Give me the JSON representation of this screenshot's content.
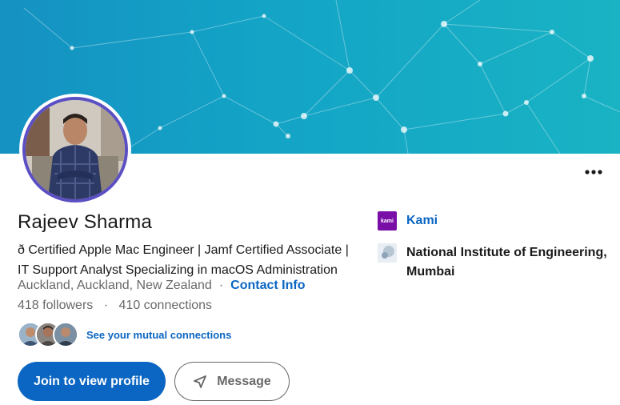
{
  "profile": {
    "name": "Rajeev Sharma",
    "headline": "ð Certified Apple Mac Engineer | Jamf Certified Associate | IT Support Analyst Specializing in macOS Administration",
    "location": "Auckland, Auckland, New Zealand",
    "separator": "·",
    "contact_info_label": "Contact Info",
    "followers": "418 followers",
    "connections": "410 connections"
  },
  "mutual": {
    "label": "See your mutual connections"
  },
  "actions": {
    "join_label": "Join to view profile",
    "message_label": "Message",
    "more_icon": "ellipsis-icon"
  },
  "experience": {
    "company": "Kami",
    "company_logo_text": "kami",
    "school": "National Institute of Engineering, Mumbai"
  },
  "colors": {
    "accent": "#0a66c2",
    "banner_start": "#1591c2",
    "banner_end": "#19b3c4",
    "kami_brand": "#7a0fa8",
    "avatar_ring": "#5b4fc4"
  }
}
